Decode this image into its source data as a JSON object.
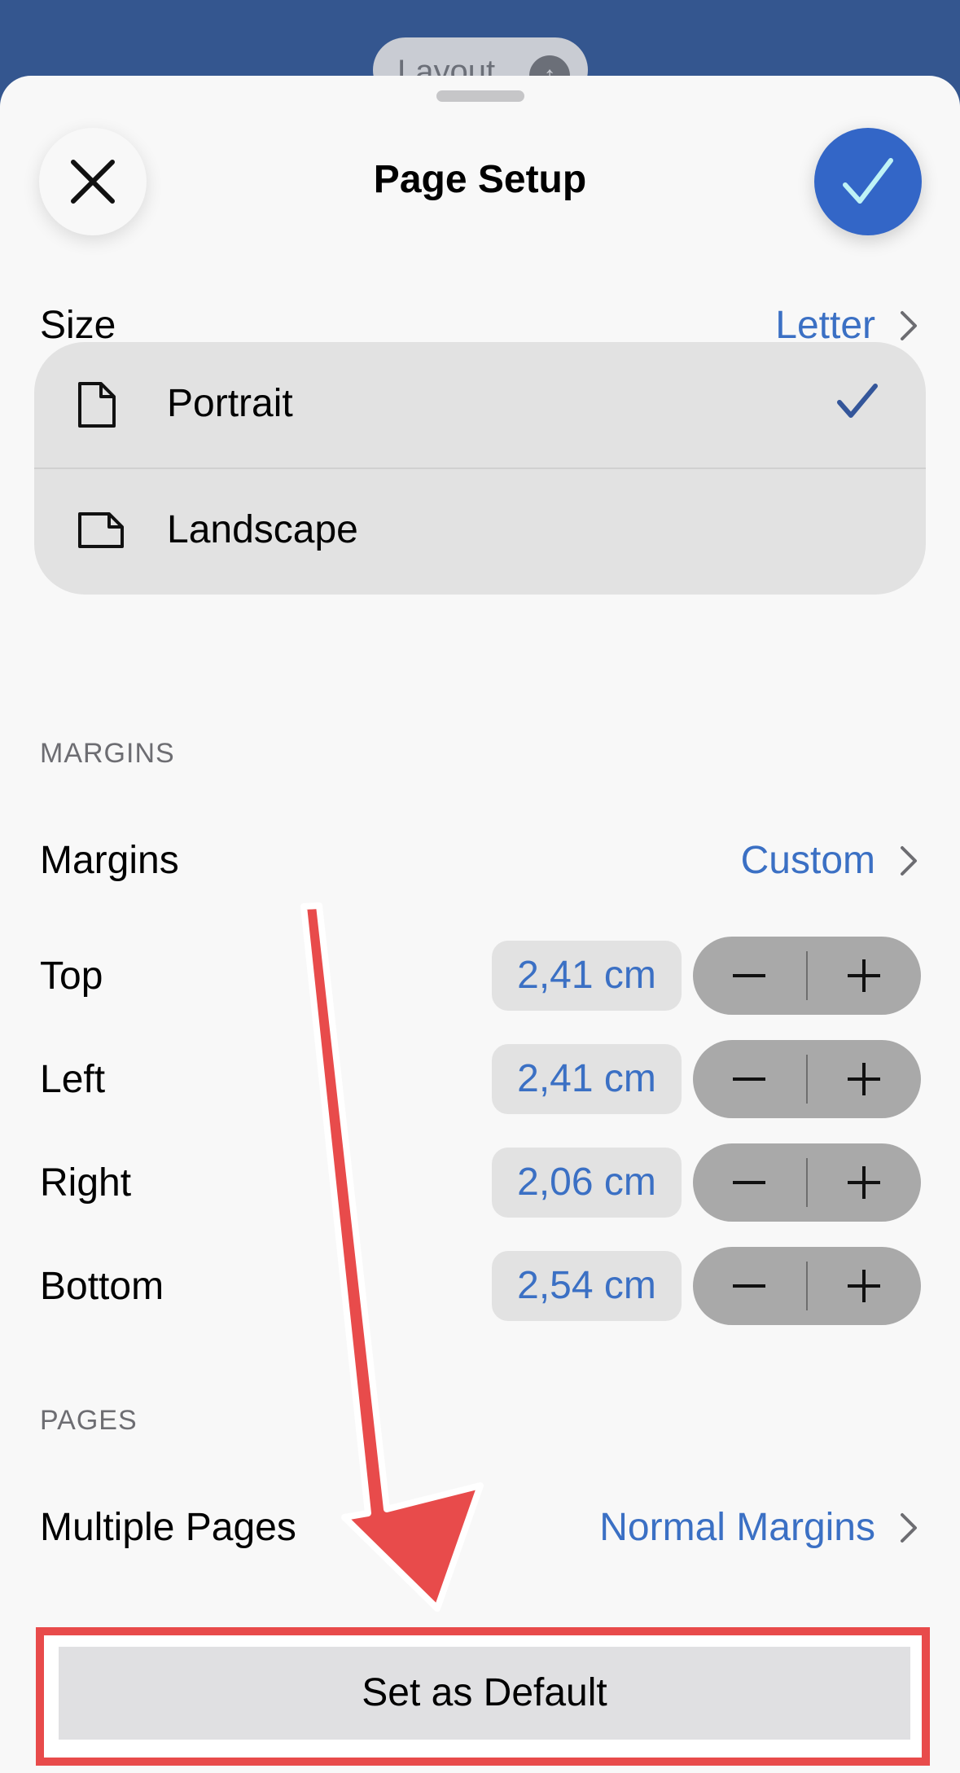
{
  "toolbar": {
    "layout_label": "Layout"
  },
  "sheet": {
    "title": "Page Setup"
  },
  "size": {
    "label": "Size",
    "value": "Letter"
  },
  "orientation": {
    "options": [
      {
        "label": "Portrait",
        "selected": true
      },
      {
        "label": "Landscape",
        "selected": false
      }
    ]
  },
  "margins": {
    "section_header": "MARGINS",
    "preset_label": "Margins",
    "preset_value": "Custom",
    "rows": [
      {
        "label": "Top",
        "value": "2,41 cm"
      },
      {
        "label": "Left",
        "value": "2,41 cm"
      },
      {
        "label": "Right",
        "value": "2,06 cm"
      },
      {
        "label": "Bottom",
        "value": "2,54 cm"
      }
    ]
  },
  "pages": {
    "section_header": "PAGES",
    "multiple_label": "Multiple Pages",
    "multiple_value": "Normal Margins"
  },
  "actions": {
    "set_default_label": "Set as Default"
  },
  "colors": {
    "accent": "#3b70c4",
    "done_button": "#3366c7",
    "annotation": "#e84b4b",
    "header_bar": "#34568f"
  },
  "icons": {
    "close": "close-icon",
    "done": "checkmark-icon",
    "chevron": "chevron-right-icon",
    "portrait": "portrait-page-icon",
    "landscape": "landscape-page-icon",
    "minus": "minus-icon",
    "plus": "plus-icon"
  }
}
